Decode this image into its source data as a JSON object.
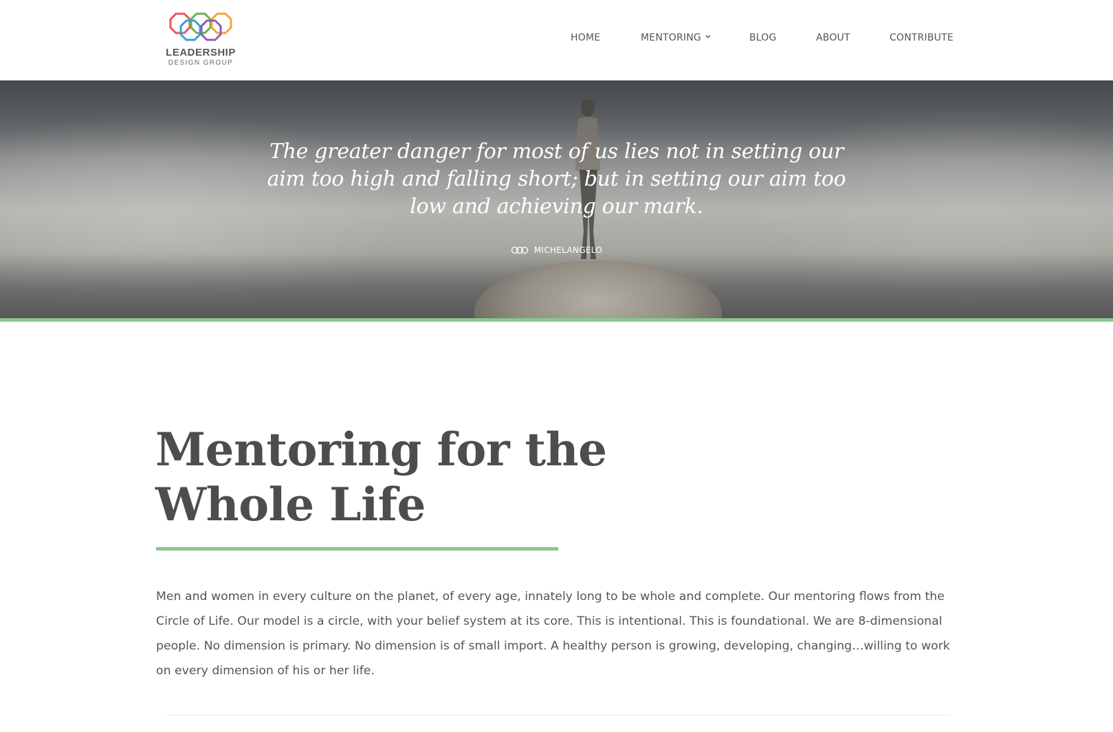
{
  "brand": {
    "logo_icon": "interlocking-octagon-rings-logo",
    "name_line1": "LEADERSHIP",
    "name_line2": "DESIGN GROUP",
    "ring_colors": [
      "#e8565a",
      "#f2a53a",
      "#6ab04c",
      "#3aa0d8",
      "#8e5bb5"
    ]
  },
  "nav": {
    "items": [
      {
        "label": "HOME"
      },
      {
        "label": "MENTORING",
        "has_dropdown": true,
        "dropdown_icon": "chevron-down-icon"
      },
      {
        "label": "BLOG"
      },
      {
        "label": "ABOUT"
      },
      {
        "label": "CONTRIBUTE"
      }
    ]
  },
  "hero": {
    "quote": "The greater danger for most of us lies not in setting our aim too high and falling short; but in setting our aim too low and achieving our mark.",
    "attribution_icon": "rings-icon",
    "attribution": "MICHELANGELO",
    "accent_color": "#89c98e"
  },
  "main": {
    "title": "Mentoring for the Whole Life",
    "body": "Men and women in every culture on the planet, of every age, innately long to be whole and complete. Our mentoring flows from the Circle of Life. Our model is a circle, with your belief system at its core. This is intentional. This is foundational. We are 8-dimensional people. No dimension is primary. No dimension is of small import. A healthy person is growing, developing, changing…willing to work on every dimension of his or her life."
  }
}
